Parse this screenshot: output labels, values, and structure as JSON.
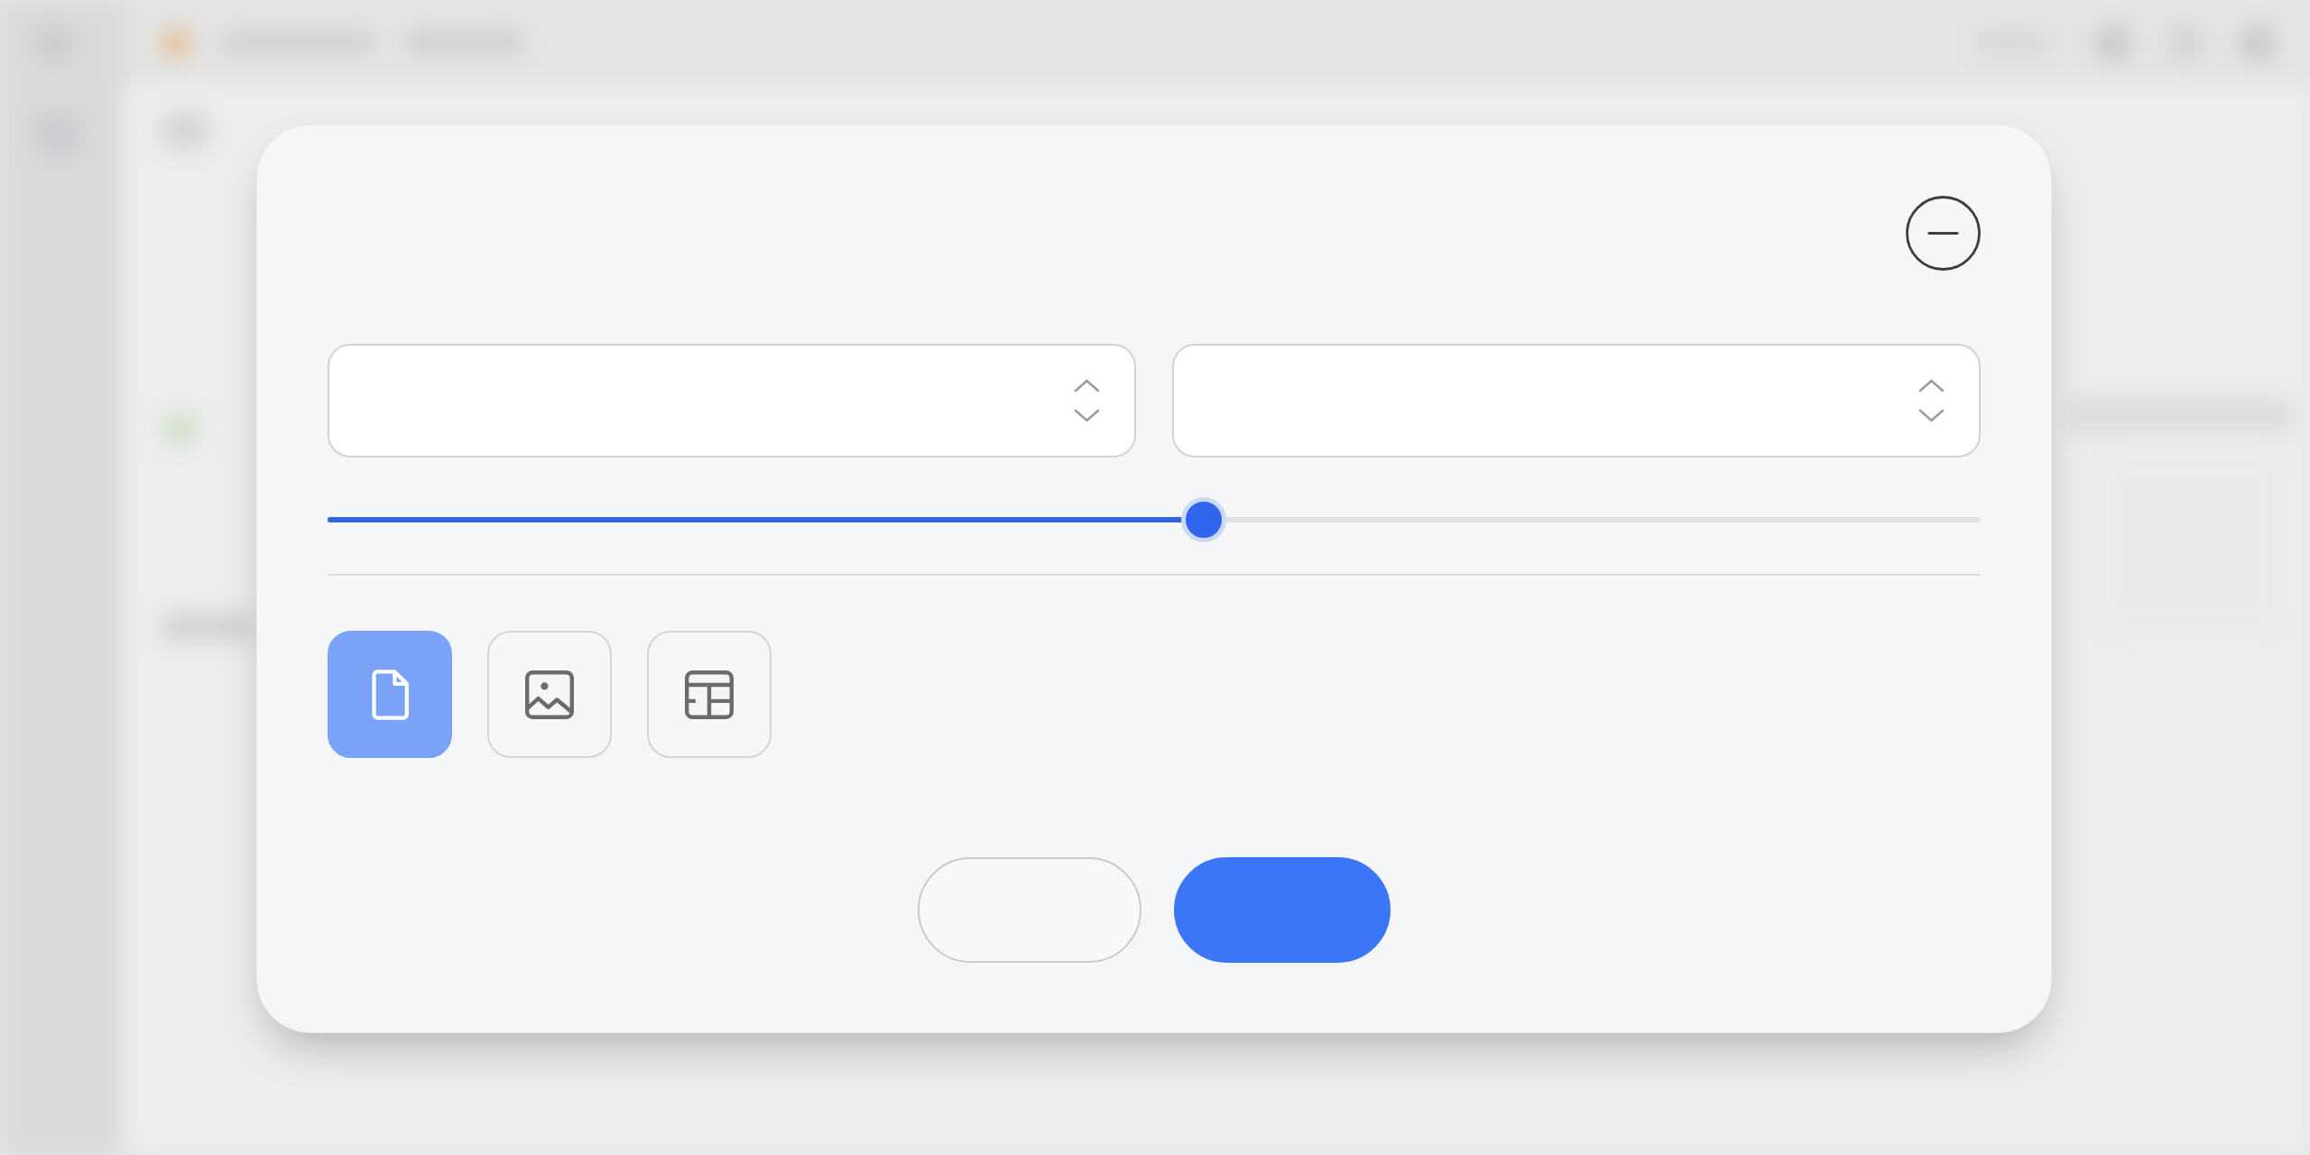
{
  "dialog": {
    "corner_button": {
      "kind": "minus"
    },
    "fields": [
      {
        "kind": "select"
      },
      {
        "kind": "select"
      }
    ],
    "slider": {
      "level": 0.53
    },
    "options": [
      {
        "kind": "document",
        "selected": true
      },
      {
        "kind": "image",
        "selected": false
      },
      {
        "kind": "layout",
        "selected": false
      }
    ],
    "buttons": [
      {
        "kind": "secondary"
      },
      {
        "kind": "primary"
      }
    ]
  }
}
